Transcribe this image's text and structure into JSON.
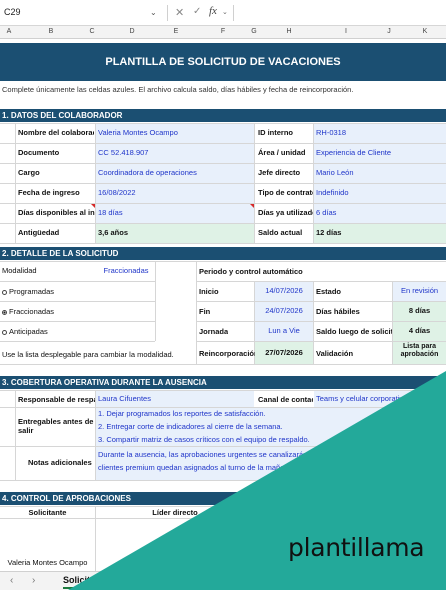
{
  "formula_bar": {
    "name_box": "C29",
    "fx": "fx"
  },
  "columns": [
    "A",
    "B",
    "C",
    "D",
    "E",
    "F",
    "G",
    "H",
    "I",
    "J",
    "K"
  ],
  "title": "PLANTILLA DE SOLICITUD DE VACACIONES",
  "note": "Complete únicamente las celdas azules. El archivo calcula saldo, días hábiles y fecha de reincorporación.",
  "sec1": {
    "header": "1. DATOS DEL COLABORADOR",
    "nombre_lbl": "Nombre del colaborador",
    "nombre_val": "Valeria Montes Ocampo",
    "id_lbl": "ID interno",
    "id_val": "RH-0318",
    "doc_lbl": "Documento",
    "doc_val": "CC 52.418.907",
    "area_lbl": "Área / unidad",
    "area_val": "Experiencia de Cliente",
    "cargo_lbl": "Cargo",
    "cargo_val": "Coordinadora de operaciones",
    "jefe_lbl": "Jefe directo",
    "jefe_val": "Mario León",
    "fingreso_lbl": "Fecha de ingreso",
    "fingreso_val": "16/08/2022",
    "tcontrato_lbl": "Tipo de contrato",
    "tcontrato_val": "Indefinido",
    "disp_lbl": "Días disponibles al inicio",
    "disp_val": "18 días",
    "util_lbl": "Días ya utilizados",
    "util_val": "6 días",
    "antig_lbl": "Antigüedad",
    "antig_val": "3,6 años",
    "saldo_lbl": "Saldo actual",
    "saldo_val": "12 días"
  },
  "sec2": {
    "header": "2. DETALLE DE LA SOLICITUD",
    "modalidad_lbl": "Modalidad",
    "modalidad_val": "Fraccionadas",
    "opt1": "Programadas",
    "opt2": "Fraccionadas",
    "opt3": "Anticipadas",
    "hint": "Use la lista desplegable para cambiar la modalidad.",
    "periodo_lbl": "Periodo y control automático",
    "inicio_lbl": "Inicio",
    "inicio_val": "14/07/2026",
    "estado_lbl": "Estado",
    "estado_val": "En revisión",
    "fin_lbl": "Fin",
    "fin_val": "24/07/2026",
    "habiles_lbl": "Días hábiles",
    "habiles_val": "8 días",
    "jornada_lbl": "Jornada",
    "jornada_val": "Lun a Vie",
    "saldo_lbl": "Saldo luego de solicitud",
    "saldo_val": "4 días",
    "reinc_lbl": "Reincorporación",
    "reinc_val": "27/07/2026",
    "valid_lbl": "Validación",
    "valid_val": "Lista para aprobación"
  },
  "sec3": {
    "header": "3. COBERTURA OPERATIVA DURANTE LA AUSENCIA",
    "resp_lbl": "Responsable de respaldo",
    "resp_val": "Laura Cifuentes",
    "canal_lbl": "Canal de contacto",
    "canal_val": "Teams y celular corporativo",
    "entreg_lbl": "Entregables antes de salir",
    "e1": "1. Dejar programados los reportes de satisfacción.",
    "e2": "2. Entregar corte de indicadores al cierre de la semana.",
    "e3": "3. Compartir matriz de casos críticos con el equipo de respaldo.",
    "notas_lbl": "Notas adicionales",
    "n1": "Durante la ausencia, las aprobaciones urgentes se canalizarán",
    "n2": "clientes premium quedan asignados al turno de la mañana."
  },
  "sec4": {
    "header": "4. CONTROL DE APROBACIONES",
    "solicitante_lbl": "Solicitante",
    "lider_lbl": "Líder directo",
    "solicitante_val": "Valeria Montes Ocampo"
  },
  "tab": {
    "name": "Solicitud"
  },
  "brand": {
    "text": "plantillama",
    "color": "#23a99a"
  },
  "colors": {
    "header_blue": "#1b4f72",
    "input_blue": "#1f35c9"
  }
}
